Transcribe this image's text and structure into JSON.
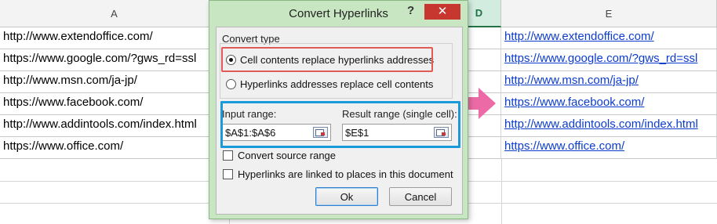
{
  "sheet": {
    "columns": {
      "A": "A",
      "D": "D",
      "E": "E"
    },
    "source_cells": [
      "http://www.extendoffice.com/",
      "https://www.google.com/?gws_rd=ssl",
      "http://www.msn.com/ja-jp/",
      "https://www.facebook.com/",
      "http://www.addintools.com/index.html",
      "https://www.office.com/"
    ],
    "result_cells": [
      "http://www.extendoffice.com/",
      "https://www.google.com/?gws_rd=ssl",
      "http://www.msn.com/ja-jp/",
      "https://www.facebook.com/",
      "http://www.addintools.com/index.html",
      "https://www.office.com/"
    ],
    "link_color": "#0b3ccd"
  },
  "arrow": {
    "icon": "pink-arrow-right-icon",
    "color": "#ec6ba6"
  },
  "dialog": {
    "title": "Convert Hyperlinks",
    "help_label": "?",
    "close_label": "✕",
    "convert_type_label": "Convert type",
    "option_cells_replace": "Cell contents replace hyperlinks addresses",
    "option_hyperlinks_replace": "Hyperlinks addresses replace cell contents",
    "selected_option": "option_cells_replace",
    "input_range_label": "Input range:",
    "input_range_value": "$A$1:$A$6",
    "result_range_label": "Result range (single cell):",
    "result_range_value": "$E$1",
    "convert_source_label": "Convert source range",
    "linked_places_label": "Hyperlinks are linked to places in this document",
    "ok_label": "Ok",
    "cancel_label": "Cancel",
    "highlight_red": "#e15a54",
    "highlight_blue": "#1a9ad8"
  }
}
